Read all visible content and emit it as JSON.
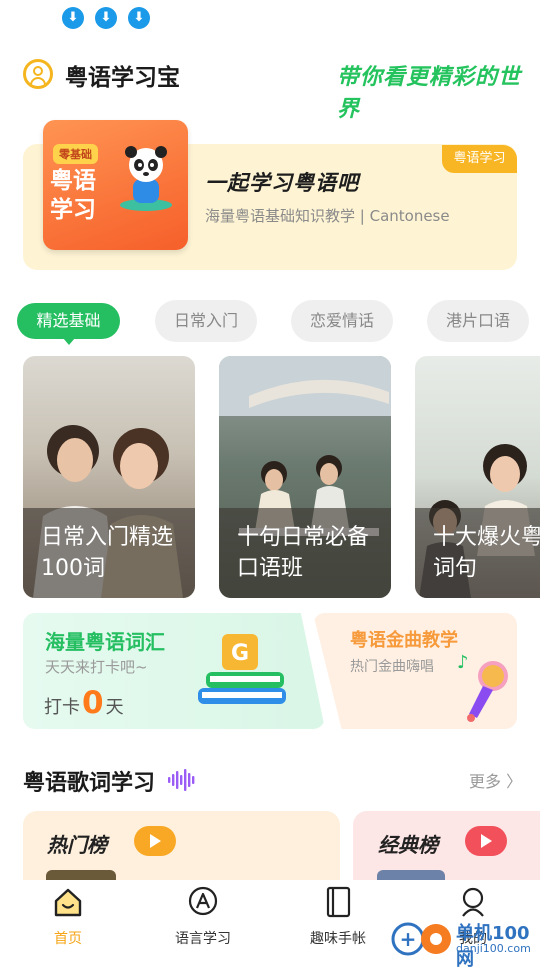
{
  "status_bar": {
    "icons": [
      "download-icon",
      "download-icon",
      "download-icon"
    ]
  },
  "header": {
    "title": "粤语学习宝",
    "slogan": "带你看更精彩的世界"
  },
  "banner": {
    "image_badge": "零基础",
    "image_text": "粤语学习",
    "tag": "粤语学习",
    "title": "一起学习粤语吧",
    "subtitle": "海量粤语基础知识教学 | Cantonese"
  },
  "tabs": [
    {
      "label": "精选基础",
      "active": true
    },
    {
      "label": "日常入门",
      "active": false
    },
    {
      "label": "恋爱情话",
      "active": false
    },
    {
      "label": "港片口语",
      "active": false
    }
  ],
  "courses": [
    {
      "line1": "日常入门精选",
      "line2": "100词"
    },
    {
      "line1": "十句日常必备",
      "line2": "口语班"
    },
    {
      "line1": "十大爆火粤",
      "line2": "词句"
    }
  ],
  "features": {
    "vocab": {
      "title": "海量粤语词汇",
      "subtitle": "天天来打卡吧~",
      "checkin_prefix": "打卡",
      "checkin_days": "0",
      "checkin_suffix": "天"
    },
    "songs": {
      "title": "粤语金曲教学",
      "subtitle": "热门金曲嗨唱"
    }
  },
  "lyrics_section": {
    "title": "粤语歌词学习",
    "more": "更多 〉",
    "lists": [
      {
        "title": "热门榜",
        "play_color": "#f9a825"
      },
      {
        "title": "经典榜",
        "play_color": "#f2505a"
      }
    ]
  },
  "bottom_nav": [
    {
      "label": "首页",
      "active": true
    },
    {
      "label": "语言学习",
      "active": false
    },
    {
      "label": "趣味手帐",
      "active": false
    },
    {
      "label": "我的",
      "active": false
    }
  ],
  "watermark": {
    "title": "单机100网",
    "url": "danji100.com"
  },
  "colors": {
    "accent": "#25bf62",
    "highlight": "#f6a516",
    "banner_tag": "#f9b624"
  }
}
